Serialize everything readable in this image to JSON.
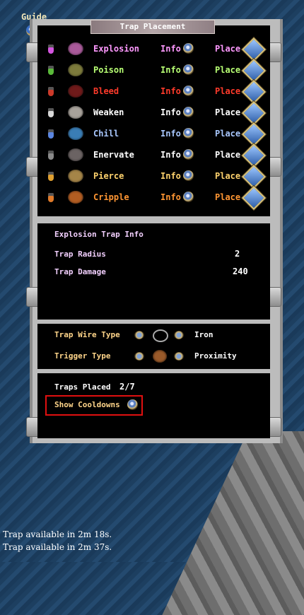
{
  "guide": {
    "label": "Guide"
  },
  "window": {
    "title": "Trap Placement"
  },
  "traps": [
    {
      "name": "Explosion",
      "color": "#ff99ff",
      "potion": "#d455e0",
      "pad": "#a95a9a",
      "info": "Info",
      "place": "Place"
    },
    {
      "name": "Poison",
      "color": "#b8ff74",
      "potion": "#5aba3a",
      "pad": "#7d7b3c",
      "info": "Info",
      "place": "Place"
    },
    {
      "name": "Bleed",
      "color": "#ff3b2b",
      "potion": "#cc3a2a",
      "pad": "#6f1a1a",
      "info": "Info",
      "place": "Place"
    },
    {
      "name": "Weaken",
      "color": "#ffffff",
      "potion": "#d8d8d8",
      "pad": "#a8a29b",
      "info": "Info",
      "place": "Place"
    },
    {
      "name": "Chill",
      "color": "#a9c8ff",
      "potion": "#5b86e0",
      "pad": "#3a7db5",
      "info": "Info",
      "place": "Place"
    },
    {
      "name": "Enervate",
      "color": "#ffffff",
      "potion": "#8a8a8a",
      "pad": "#6b6363",
      "info": "Info",
      "place": "Place"
    },
    {
      "name": "Pierce",
      "color": "#ffd36e",
      "potion": "#e0a030",
      "pad": "#a58548",
      "info": "Info",
      "place": "Place"
    },
    {
      "name": "Cripple",
      "color": "#ff9633",
      "potion": "#e07a2a",
      "pad": "#b25d22",
      "info": "Info",
      "place": "Place"
    }
  ],
  "info_panel": {
    "title": "Explosion Trap Info",
    "stats": [
      {
        "label": "Trap Radius",
        "value": "2"
      },
      {
        "label": "Trap Damage",
        "value": "240"
      }
    ]
  },
  "settings": {
    "wire_label": "Trap Wire Type",
    "wire_value": "Iron",
    "trigger_label": "Trigger Type",
    "trigger_value": "Proximity"
  },
  "status": {
    "placed_label": "Traps Placed",
    "placed_value": "2/7",
    "cooldowns_label": "Show Cooldowns"
  },
  "messages": [
    "Trap available in 2m 18s.",
    "Trap available in 2m 37s."
  ]
}
